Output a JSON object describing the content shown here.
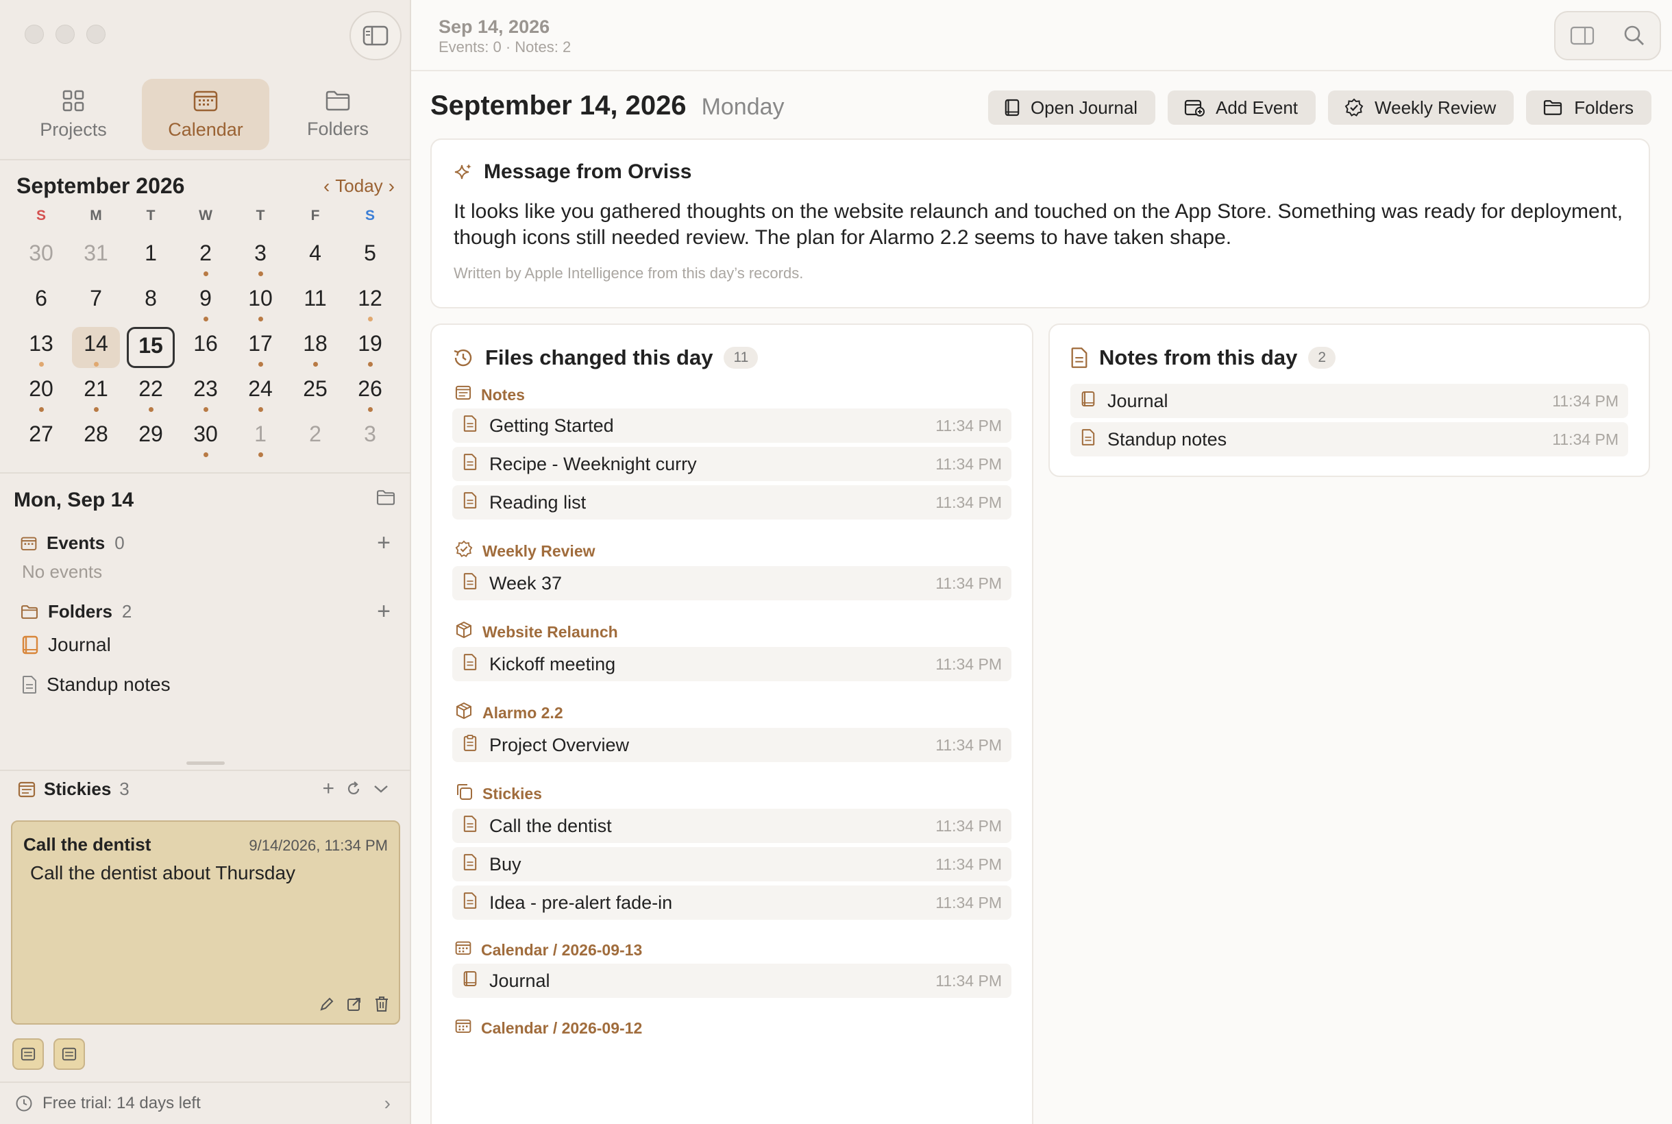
{
  "sidebar": {
    "tabs": [
      {
        "label": "Projects",
        "icon": "grid-icon"
      },
      {
        "label": "Calendar",
        "icon": "calendar-icon"
      },
      {
        "label": "Folders",
        "icon": "folder-icon"
      }
    ],
    "calendar": {
      "month": "September 2026",
      "today_label": "Today",
      "weekdays": [
        "S",
        "M",
        "T",
        "W",
        "T",
        "F",
        "S"
      ],
      "days": [
        {
          "d": "30",
          "other": true,
          "dot": false
        },
        {
          "d": "31",
          "other": true,
          "dot": false
        },
        {
          "d": "1",
          "dot": false
        },
        {
          "d": "2",
          "dot": true
        },
        {
          "d": "3",
          "dot": true
        },
        {
          "d": "4",
          "dot": false
        },
        {
          "d": "5",
          "dot": false
        },
        {
          "d": "6",
          "dot": false
        },
        {
          "d": "7",
          "dot": false
        },
        {
          "d": "8",
          "dot": false
        },
        {
          "d": "9",
          "dot": true
        },
        {
          "d": "10",
          "dot": true
        },
        {
          "d": "11",
          "dot": false
        },
        {
          "d": "12",
          "dot": true,
          "light": true
        },
        {
          "d": "13",
          "dot": true,
          "light": true
        },
        {
          "d": "14",
          "dot": true,
          "light": true,
          "selected": true
        },
        {
          "d": "15",
          "today": true,
          "dot": false
        },
        {
          "d": "16",
          "dot": false
        },
        {
          "d": "17",
          "dot": true
        },
        {
          "d": "18",
          "dot": true
        },
        {
          "d": "19",
          "dot": true
        },
        {
          "d": "20",
          "dot": true
        },
        {
          "d": "21",
          "dot": true
        },
        {
          "d": "22",
          "dot": true
        },
        {
          "d": "23",
          "dot": true
        },
        {
          "d": "24",
          "dot": true
        },
        {
          "d": "25",
          "dot": false
        },
        {
          "d": "26",
          "dot": true
        },
        {
          "d": "27",
          "dot": false
        },
        {
          "d": "28",
          "dot": false
        },
        {
          "d": "29",
          "dot": false
        },
        {
          "d": "30",
          "dot": true
        },
        {
          "d": "1",
          "other": true,
          "dot": true
        },
        {
          "d": "2",
          "other": true,
          "dot": false
        },
        {
          "d": "3",
          "other": true,
          "dot": false
        }
      ]
    },
    "day_title": "Mon, Sep 14",
    "events": {
      "label": "Events",
      "count": "0",
      "empty": "No events"
    },
    "folders": {
      "label": "Folders",
      "count": "2",
      "items": [
        "Journal",
        "Standup notes"
      ]
    },
    "stickies": {
      "label": "Stickies",
      "count": "3",
      "current": {
        "title": "Call the dentist",
        "date": "9/14/2026, 11:34 PM",
        "body": "Call the dentist about Thursday"
      }
    },
    "trial": "Free trial: 14 days left"
  },
  "topbar": {
    "date": "Sep 14, 2026",
    "meta": "Events: 0 · Notes: 2"
  },
  "main": {
    "title": "September 14, 2026",
    "weekday": "Monday",
    "actions": [
      "Open Journal",
      "Add Event",
      "Weekly Review",
      "Folders"
    ],
    "message": {
      "title": "Message from Orviss",
      "body": "It looks like you gathered thoughts on the website relaunch and touched on the App Store. Something was ready for deployment, though icons still needed review. The plan for Alarmo 2.2 seems to have taken shape.",
      "footer": "Written by Apple Intelligence from this day’s records."
    },
    "files": {
      "title": "Files changed this day",
      "count": "11",
      "groups": [
        {
          "name": "Notes",
          "icon": "notes-icon",
          "items": [
            {
              "name": "Getting Started",
              "time": "11:34 PM",
              "icon": "doc"
            },
            {
              "name": "Recipe - Weeknight curry",
              "time": "11:34 PM",
              "icon": "doc"
            },
            {
              "name": "Reading list",
              "time": "11:34 PM",
              "icon": "doc"
            }
          ]
        },
        {
          "name": "Weekly Review",
          "icon": "badge-check-icon",
          "items": [
            {
              "name": "Week 37",
              "time": "11:34 PM",
              "icon": "doc"
            }
          ]
        },
        {
          "name": "Website Relaunch",
          "icon": "cube-icon",
          "items": [
            {
              "name": "Kickoff meeting",
              "time": "11:34 PM",
              "icon": "doc"
            }
          ]
        },
        {
          "name": "Alarmo 2.2",
          "icon": "cube-icon",
          "items": [
            {
              "name": "Project Overview",
              "time": "11:34 PM",
              "icon": "clipboard"
            }
          ]
        },
        {
          "name": "Stickies",
          "icon": "stack-icon",
          "items": [
            {
              "name": "Call the dentist",
              "time": "11:34 PM",
              "icon": "doc"
            },
            {
              "name": "Buy",
              "time": "11:34 PM",
              "icon": "doc"
            },
            {
              "name": "Idea - pre-alert fade-in",
              "time": "11:34 PM",
              "icon": "doc"
            }
          ]
        },
        {
          "name": "Calendar / 2026-09-13",
          "icon": "calendar-icon",
          "items": [
            {
              "name": "Journal",
              "time": "11:34 PM",
              "icon": "book"
            }
          ]
        },
        {
          "name": "Calendar / 2026-09-12",
          "icon": "calendar-icon",
          "items": []
        }
      ]
    },
    "notes": {
      "title": "Notes from this day",
      "count": "2",
      "items": [
        {
          "name": "Journal",
          "time": "11:34 PM",
          "icon": "book"
        },
        {
          "name": "Standup notes",
          "time": "11:34 PM",
          "icon": "doc"
        }
      ]
    }
  },
  "colors": {
    "accent": "#9a6233",
    "sidebar_bg": "#f0ebe6",
    "sticky_bg": "#e3d4ae"
  }
}
